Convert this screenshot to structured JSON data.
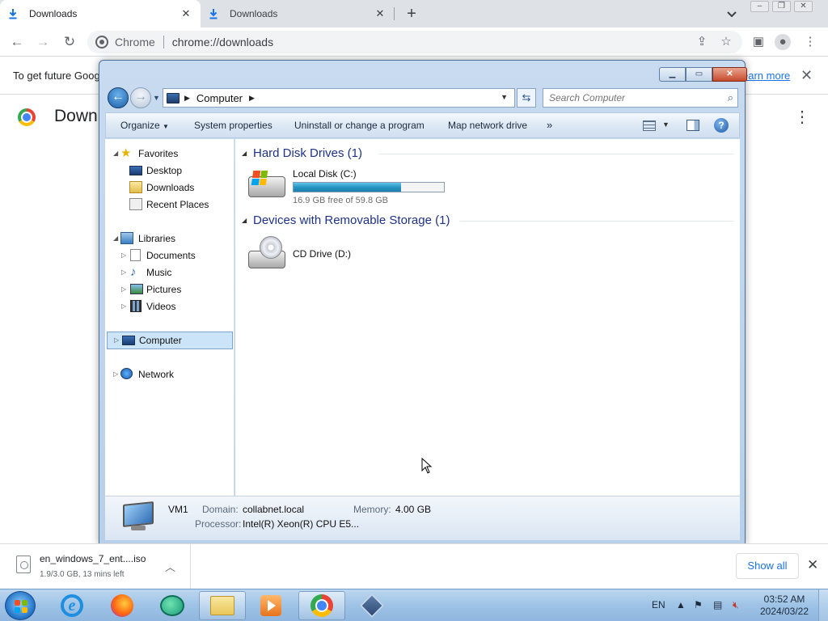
{
  "browser": {
    "tabs": [
      {
        "label": "Downloads",
        "active": true
      },
      {
        "label": "Downloads",
        "active": false
      }
    ],
    "new_tab_glyph": "+",
    "url_chip": "Chrome",
    "url": "chrome://downloads"
  },
  "downloads_page": {
    "infobar_text": "To get future Goog",
    "infobar_link": "earn more",
    "title": "Down"
  },
  "explorer": {
    "address": {
      "crumb": "Computer"
    },
    "search_placeholder": "Search Computer",
    "command_bar": {
      "organize": "Organize",
      "system_properties": "System properties",
      "uninstall": "Uninstall or change a program",
      "map_drive": "Map network drive",
      "more": "»"
    },
    "nav": {
      "favorites": "Favorites",
      "desktop": "Desktop",
      "downloads": "Downloads",
      "recent_places": "Recent Places",
      "libraries": "Libraries",
      "documents": "Documents",
      "music": "Music",
      "pictures": "Pictures",
      "videos": "Videos",
      "computer": "Computer",
      "network": "Network"
    },
    "groups": {
      "hdd_header": "Hard Disk Drives (1)",
      "removable_header": "Devices with Removable Storage (1)"
    },
    "drives": {
      "c_name": "Local Disk (C:)",
      "c_free": "16.9 GB free of 59.8 GB",
      "c_used_fraction": 0.717,
      "d_name": "CD Drive (D:)"
    },
    "details": {
      "name": "VM1",
      "domain_label": "Domain:",
      "domain_value": "collabnet.local",
      "memory_label": "Memory:",
      "memory_value": "4.00 GB",
      "processor_label": "Processor:",
      "processor_value": "Intel(R) Xeon(R) CPU E5..."
    }
  },
  "shelf": {
    "file_name": "en_windows_7_ent....iso",
    "status": "1.9/3.0 GB, 13 mins left",
    "show_all": "Show all"
  },
  "taskbar": {
    "language": "EN",
    "time": "03:52 AM",
    "date": "2024/03/22"
  },
  "colors": {
    "chrome_blue": "#1a73e8",
    "explorer_header_blue": "#1e3287",
    "drive_bar": "#2795c2",
    "taskbar": "#9fc3e6"
  }
}
